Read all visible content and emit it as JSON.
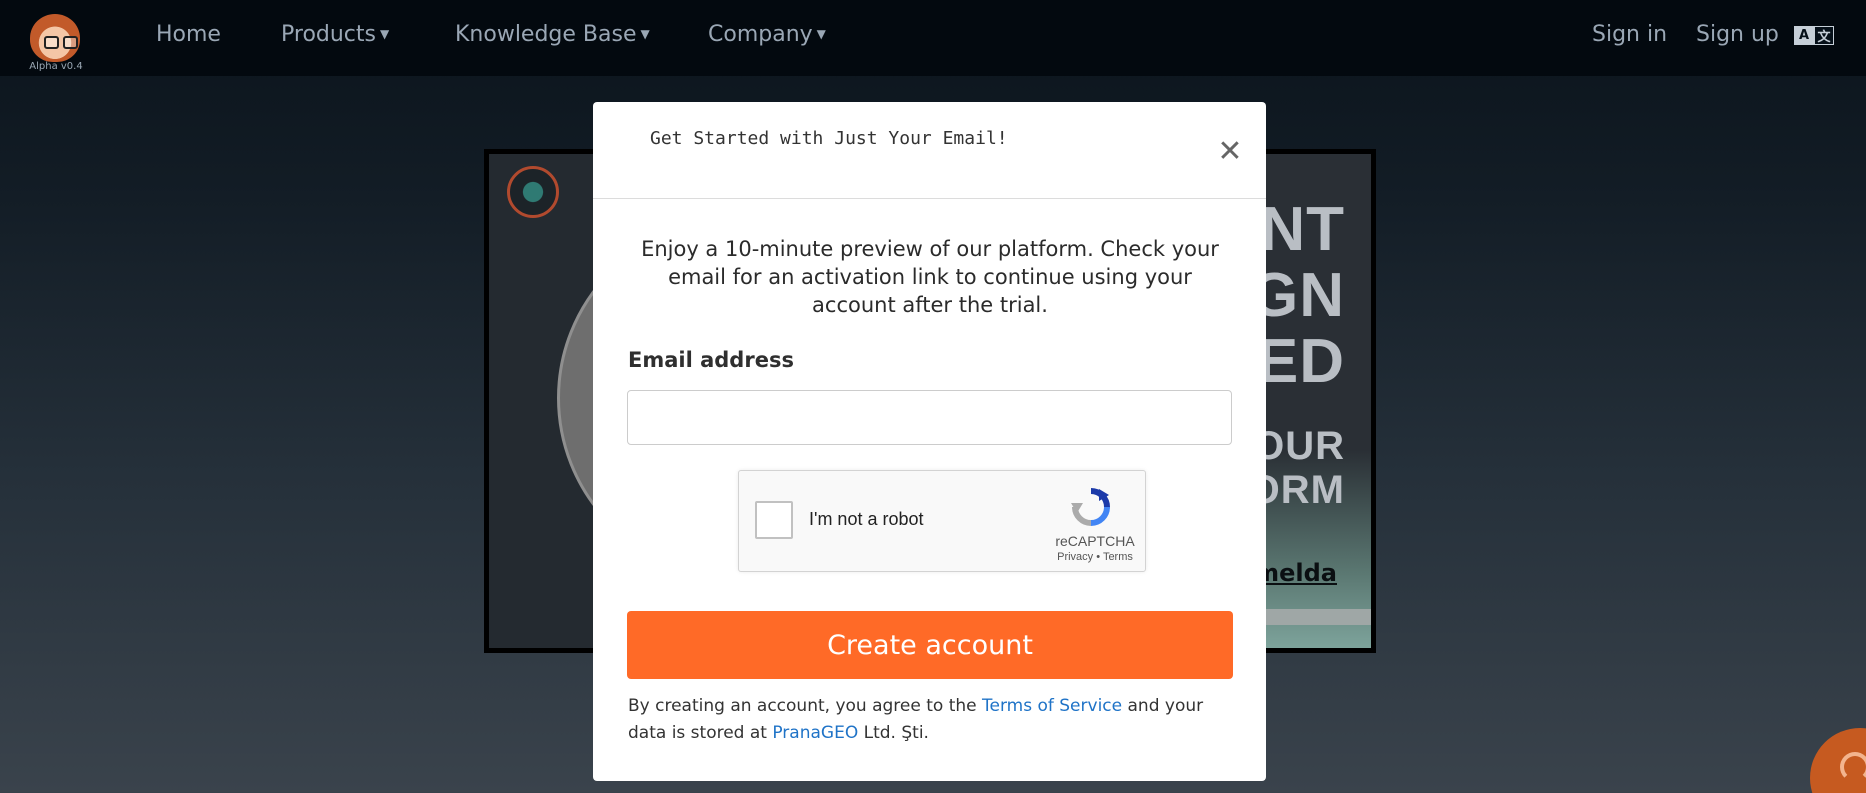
{
  "nav": {
    "logo_caption": "Alpha v0.4",
    "items": [
      {
        "label": "Home",
        "has_caret": false
      },
      {
        "label": "Products",
        "has_caret": true
      },
      {
        "label": "Knowledge Base",
        "has_caret": true
      },
      {
        "label": "Company",
        "has_caret": true
      }
    ],
    "sign_in": "Sign in",
    "sign_up": "Sign up",
    "language_icon": "translate-icon"
  },
  "hero": {
    "lines_big": [
      "ENT",
      "IGN",
      "TED"
    ],
    "lines_mid": [
      "OUR",
      "ORM"
    ],
    "link_text": "melda"
  },
  "modal": {
    "title": "Get Started with Just Your Email!",
    "close_icon": "close-icon",
    "description": "Enjoy a 10-minute preview of our platform. Check your email for an activation link to continue using your account after the trial.",
    "email_label": "Email address",
    "email_value": "",
    "email_placeholder": "",
    "captcha": {
      "label": "I'm not a robot",
      "brand": "reCAPTCHA",
      "privacy": "Privacy",
      "separator": " • ",
      "terms": "Terms"
    },
    "submit_label": "Create account",
    "terms": {
      "prefix": "By creating an account, you agree to the ",
      "tos_link": "Terms of Service",
      "middle": " and your data is stored at ",
      "company_link": "PranaGEO",
      "suffix": " Ltd. Şti."
    }
  },
  "colors": {
    "accent": "#ff6a27",
    "link": "#1f73c7",
    "nav_bg": "#03090f"
  }
}
